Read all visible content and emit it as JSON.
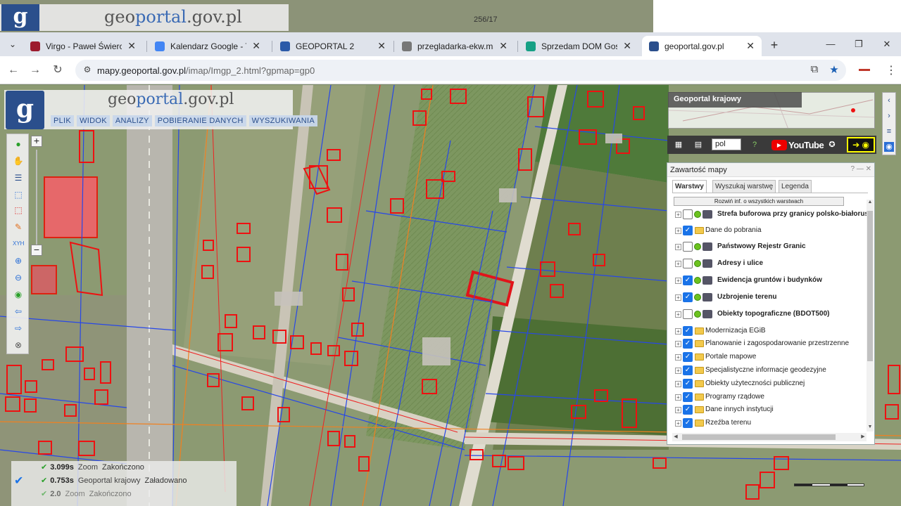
{
  "browser": {
    "tabs": [
      {
        "title": "Virgo - Paweł Świercz",
        "favicon_color": "#9c1b2e"
      },
      {
        "title": "Kalendarz Google - Tydzień",
        "favicon_color": "#4285f4"
      },
      {
        "title": "GEOPORTAL 2",
        "favicon_color": "#2b5aa8"
      },
      {
        "title": "przegladarka-ekw.ms.gov.pl",
        "favicon_color": "#777777"
      },
      {
        "title": "Sprzedam DOM Gospodarczy",
        "favicon_color": "#16a085"
      },
      {
        "title": "geoportal.gov.pl",
        "favicon_color": "#2b4f8c"
      }
    ],
    "active_tab_index": 5,
    "url_host": "mapy.geoportal.gov.pl",
    "url_path": "/imap/Imgp_2.html?gpmap=gp0"
  },
  "topstrip": {
    "site_prefix": "geo",
    "site_accent": "portal",
    "site_suffix": ".gov.pl",
    "parcel_label": "256/17"
  },
  "geoportal": {
    "logo_letter": "g",
    "title_prefix": "geo",
    "title_accent": "portal",
    "title_suffix": ".gov.pl",
    "menu": [
      "PLIK",
      "WIDOK",
      "ANALIZY",
      "POBIERANIE DANYCH",
      "WYSZUKIWANIA"
    ]
  },
  "overview": {
    "title": "Geoportal krajowy"
  },
  "iconbar": {
    "language": "pol",
    "youtube": "YouTube"
  },
  "panel": {
    "title": "Zawartość mapy",
    "tabs": [
      "Warstwy",
      "Wyszukaj warstwę",
      "Legenda"
    ],
    "expand_all": "Rozwiń inf. o wszystkich warstwach",
    "layers": [
      {
        "label": "Strefa buforowa przy granicy polsko-białoruskiej",
        "checked": false,
        "kind": "service",
        "bold": true
      },
      {
        "label": "Dane do pobrania",
        "checked": true,
        "kind": "folder",
        "bold": false
      },
      {
        "label": "Państwowy Rejestr Granic",
        "checked": false,
        "kind": "service",
        "bold": true
      },
      {
        "label": "Adresy i ulice",
        "checked": false,
        "kind": "service",
        "bold": true
      },
      {
        "label": "Ewidencja gruntów i budynków",
        "checked": true,
        "kind": "service",
        "bold": true
      },
      {
        "label": "Uzbrojenie terenu",
        "checked": true,
        "kind": "service",
        "bold": true
      },
      {
        "label": "Obiekty topograficzne (BDOT500)",
        "checked": false,
        "kind": "service",
        "bold": true
      },
      {
        "label": "Modernizacja EGiB",
        "checked": true,
        "kind": "folder",
        "bold": false
      },
      {
        "label": "Planowanie i zagospodarowanie przestrzenne",
        "checked": true,
        "kind": "folder",
        "bold": false
      },
      {
        "label": "Portale mapowe",
        "checked": true,
        "kind": "folder",
        "bold": false
      },
      {
        "label": "Specjalistyczne informacje geodezyjne",
        "checked": true,
        "kind": "folder",
        "bold": false
      },
      {
        "label": "Obiekty użyteczności publicznej",
        "checked": true,
        "kind": "folder",
        "bold": false
      },
      {
        "label": "Programy rządowe",
        "checked": true,
        "kind": "folder",
        "bold": false
      },
      {
        "label": "Dane innych instytucji",
        "checked": true,
        "kind": "folder",
        "bold": false
      },
      {
        "label": "Rzeźba terenu",
        "checked": true,
        "kind": "folder",
        "bold": false
      }
    ]
  },
  "status": {
    "rows": [
      {
        "time": "3.099s",
        "name": "Zoom",
        "state": "Zakończono"
      },
      {
        "time": "0.753s",
        "name": "Geoportal krajowy",
        "state": "Załadowano"
      },
      {
        "time": "2.0",
        "name": "Zoom",
        "state": "Zakończono"
      }
    ]
  }
}
